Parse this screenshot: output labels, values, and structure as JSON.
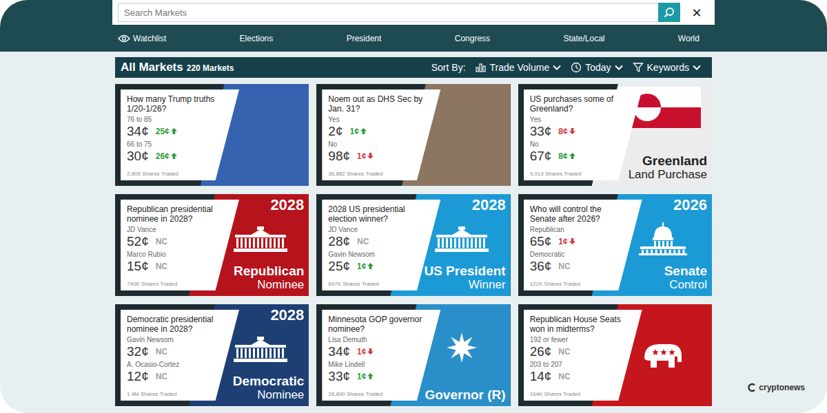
{
  "search": {
    "placeholder": "Search Markets",
    "close": "✕"
  },
  "nav": [
    {
      "label": "Watchlist",
      "kind": "watchlist"
    },
    {
      "label": "Elections",
      "kind": "link"
    },
    {
      "label": "President",
      "kind": "link"
    },
    {
      "label": "Congress",
      "kind": "link"
    },
    {
      "label": "State/Local",
      "kind": "link"
    },
    {
      "label": "World",
      "kind": "link"
    }
  ],
  "header": {
    "title": "All Markets",
    "count": "220 Markets",
    "sort_label": "Sort By:",
    "filters": [
      {
        "label": "Trade Volume",
        "kind": "volume"
      },
      {
        "label": "Today",
        "kind": "time"
      },
      {
        "label": "Keywords",
        "kind": "keywords"
      }
    ]
  },
  "markets": [
    {
      "question": "How many Trump truths 1/20-1/26?",
      "options": [
        {
          "label": "76 to 85",
          "price": "34¢",
          "change": "25¢",
          "trend": "up"
        },
        {
          "label": "66 to 75",
          "price": "30¢",
          "change": "26¢",
          "trend": "up"
        }
      ],
      "shares": "2,805 Shares Traded",
      "art": {
        "kind": "photo",
        "color": "#3563b0"
      }
    },
    {
      "question": "Noem out as DHS Sec by Jan. 31?",
      "options": [
        {
          "label": "Yes",
          "price": "2¢",
          "change": "1¢",
          "trend": "up"
        },
        {
          "label": "No",
          "price": "98¢",
          "change": "1¢",
          "trend": "down"
        }
      ],
      "shares": "36,882 Shares Traded",
      "art": {
        "kind": "photo",
        "color": "#8c7662"
      }
    },
    {
      "question": "US purchases some of Greenland?",
      "options": [
        {
          "label": "Yes",
          "price": "33¢",
          "change": "8¢",
          "trend": "down"
        },
        {
          "label": "No",
          "price": "67¢",
          "change": "8¢",
          "trend": "up"
        }
      ],
      "shares": "9,913 Shares Traded",
      "art": {
        "kind": "greenland",
        "color": "#ececec",
        "title": "Greenland",
        "subtitle": "Land Purchase"
      }
    },
    {
      "question": "Republican presidential nominee in 2028?",
      "options": [
        {
          "label": "JD Vance",
          "price": "52¢",
          "change": "NC",
          "trend": "flat"
        },
        {
          "label": "Marco Rubio",
          "price": "15¢",
          "change": "NC",
          "trend": "flat"
        }
      ],
      "shares": "740K Shares Traded",
      "art": {
        "kind": "whitehouse",
        "color": "#b5141d",
        "year": "2028",
        "title": "Republican",
        "subtitle": "Nominee"
      }
    },
    {
      "question": "2028 US presidential election winner?",
      "options": [
        {
          "label": "JD Vance",
          "price": "28¢",
          "change": "NC",
          "trend": "flat"
        },
        {
          "label": "Gavin Newsom",
          "price": "25¢",
          "change": "1¢",
          "trend": "up"
        }
      ],
      "shares": "697K Shares Traded",
      "art": {
        "kind": "whitehouse",
        "color": "#1c9ad6",
        "year": "2028",
        "title": "US President",
        "subtitle": "Winner"
      }
    },
    {
      "question": "Who will control the Senate after 2026?",
      "options": [
        {
          "label": "Republican",
          "price": "65¢",
          "change": "1¢",
          "trend": "down"
        },
        {
          "label": "Democratic",
          "price": "36¢",
          "change": "NC",
          "trend": "flat"
        }
      ],
      "shares": "122K Shares Traded",
      "art": {
        "kind": "capitol",
        "color": "#1c9ad6",
        "year": "2026",
        "title": "Senate",
        "subtitle": "Control"
      }
    },
    {
      "question": "Democratic presidential nominee in 2028?",
      "options": [
        {
          "label": "Gavin Newsom",
          "price": "32¢",
          "change": "NC",
          "trend": "flat"
        },
        {
          "label": "A. Ocasio-Cortez",
          "price": "12¢",
          "change": "NC",
          "trend": "flat"
        }
      ],
      "shares": "1.4M Shares Traded",
      "art": {
        "kind": "whitehouse",
        "color": "#1d3f74",
        "year": "2028",
        "title": "Democratic",
        "subtitle": "Nominee"
      }
    },
    {
      "question": "Minnesota GOP governor nominee?",
      "options": [
        {
          "label": "Lisa Demuth",
          "price": "34¢",
          "change": "1¢",
          "trend": "down"
        },
        {
          "label": "Mike Lindell",
          "price": "33¢",
          "change": "1¢",
          "trend": "up"
        }
      ],
      "shares": "26,890 Shares Traded",
      "art": {
        "kind": "star",
        "color": "#2a8fc8",
        "title": "Governor (R)"
      }
    },
    {
      "question": "Republican House Seats won in midterms?",
      "options": [
        {
          "label": "192 or fewer",
          "price": "26¢",
          "change": "NC",
          "trend": "flat"
        },
        {
          "label": "203 to 207",
          "price": "14¢",
          "change": "NC",
          "trend": "flat"
        }
      ],
      "shares": "164K Shares Traded",
      "art": {
        "kind": "elephant",
        "color": "#c4161c"
      }
    }
  ],
  "watermark": "cryptonews"
}
